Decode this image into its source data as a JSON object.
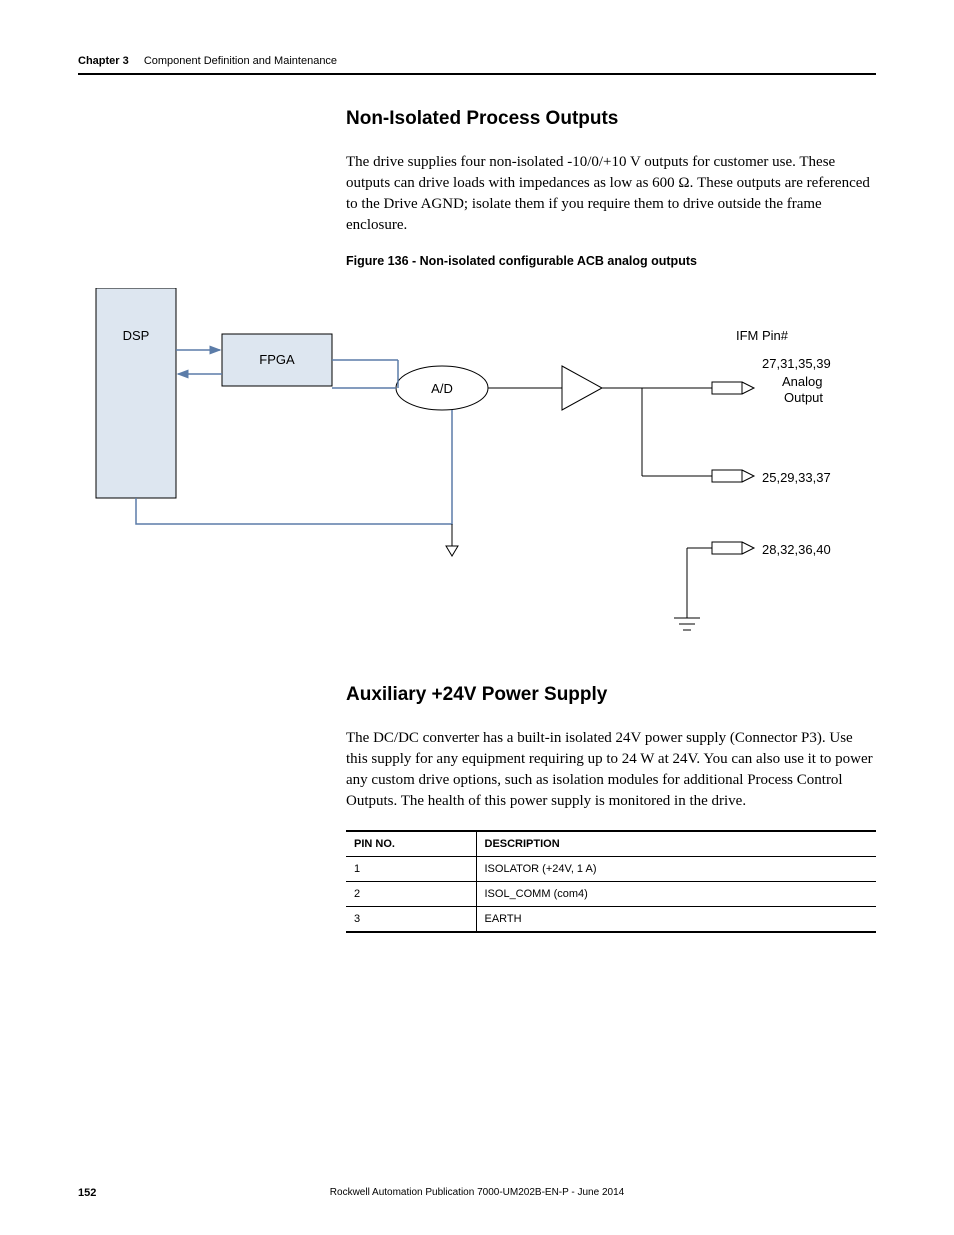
{
  "header": {
    "chapter_label": "Chapter 3",
    "chapter_title": "Component Definition and Maintenance"
  },
  "section1": {
    "heading": "Non-Isolated Process Outputs",
    "paragraph": "The drive supplies four non-isolated -10/0/+10 V outputs for customer use. These outputs can drive loads with impedances as low as 600 Ω. These outputs are referenced to the Drive AGND; isolate them if you require them to drive outside the frame enclosure.",
    "figure_caption": "Figure 136 - Non-isolated configurable ACB analog outputs"
  },
  "diagram": {
    "dsp": "DSP",
    "fpga": "FPGA",
    "ad": "A/D",
    "ifm": "IFM Pin#",
    "pins1": "27,31,35,39",
    "pins1_label": "Analog\nOutput",
    "pins2": "25,29,33,37",
    "pins3": "28,32,36,40"
  },
  "section2": {
    "heading": "Auxiliary +24V Power Supply",
    "paragraph": "The DC/DC converter has a built-in isolated 24V power supply (Connector P3). Use this supply for any equipment requiring up to 24 W at 24V. You can also use it to power any custom drive options, such as isolation modules for additional Process Control Outputs. The health of this power supply is monitored in the drive."
  },
  "table": {
    "headers": {
      "col1": "PIN NO.",
      "col2": "DESCRIPTION"
    },
    "rows": [
      {
        "pin": "1",
        "desc": "ISOLATOR (+24V, 1 A)"
      },
      {
        "pin": "2",
        "desc": "ISOL_COMM (com4)"
      },
      {
        "pin": "3",
        "desc": "EARTH"
      }
    ]
  },
  "footer": {
    "page": "152",
    "pub": "Rockwell Automation Publication 7000-UM202B-EN-P - June 2014"
  }
}
